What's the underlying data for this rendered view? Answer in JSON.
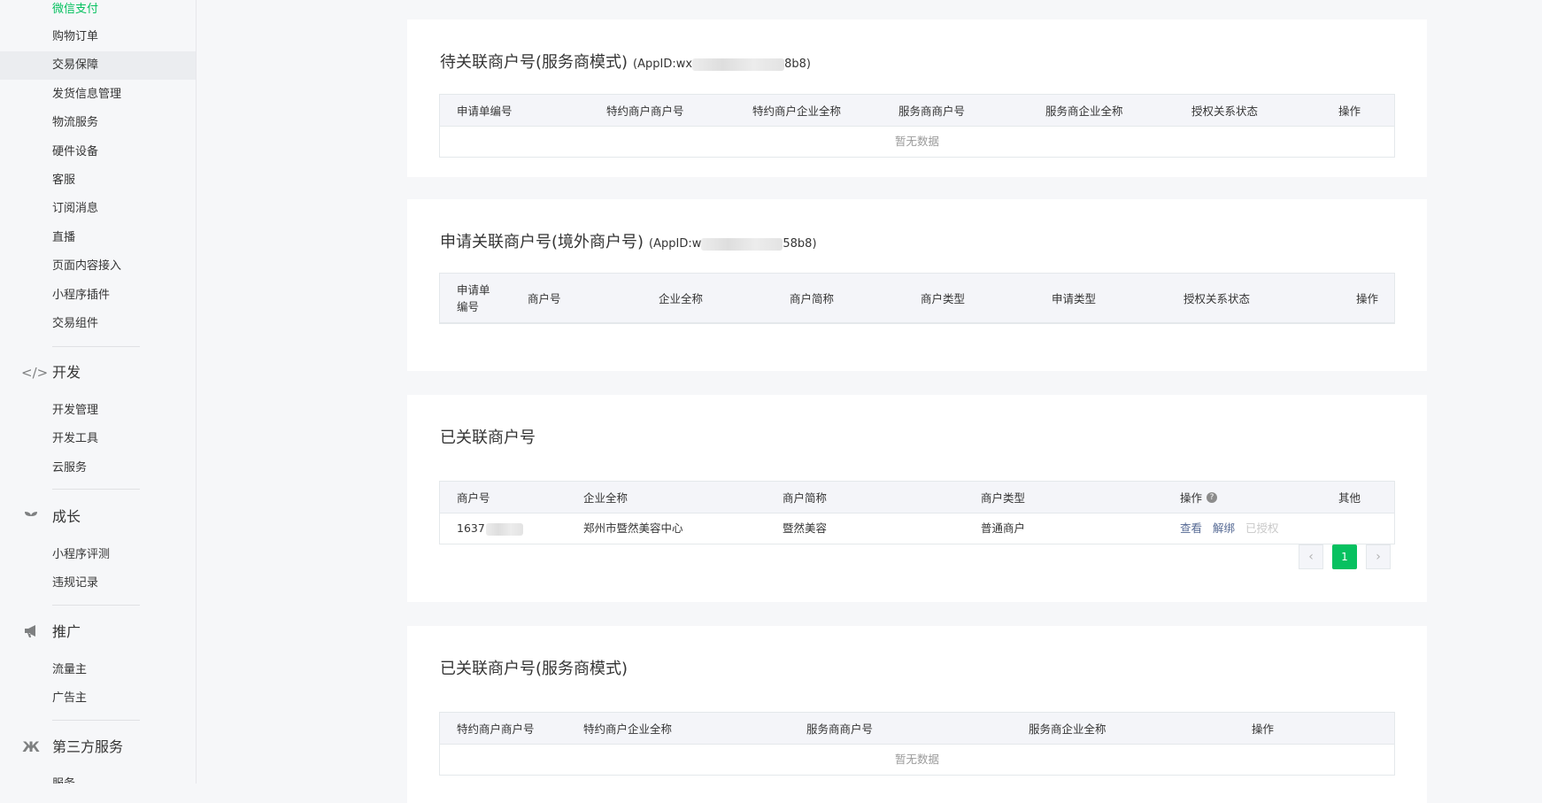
{
  "sidebar": {
    "items_top": [
      {
        "label": "微信支付"
      },
      {
        "label": "购物订单"
      },
      {
        "label": "交易保障"
      },
      {
        "label": "发货信息管理"
      },
      {
        "label": "物流服务"
      },
      {
        "label": "硬件设备"
      },
      {
        "label": "客服"
      },
      {
        "label": "订阅消息"
      },
      {
        "label": "直播"
      },
      {
        "label": "页面内容接入"
      },
      {
        "label": "小程序插件"
      },
      {
        "label": "交易组件"
      }
    ],
    "groups": [
      {
        "label": "开发",
        "icon": "code-icon",
        "items": [
          {
            "label": "开发管理"
          },
          {
            "label": "开发工具"
          },
          {
            "label": "云服务"
          }
        ]
      },
      {
        "label": "成长",
        "icon": "sprout-icon",
        "items": [
          {
            "label": "小程序评测"
          },
          {
            "label": "违规记录"
          }
        ]
      },
      {
        "label": "推广",
        "icon": "megaphone-icon",
        "items": [
          {
            "label": "流量主"
          },
          {
            "label": "广告主"
          }
        ]
      },
      {
        "label": "第三方服务",
        "icon": "third-party-icon",
        "items": [
          {
            "label": "服务"
          }
        ]
      }
    ]
  },
  "panel1": {
    "title": "待关联商户号(服务商模式)",
    "appid_prefix": "(AppID:wx",
    "appid_suffix": "8b8)",
    "columns": [
      "申请单编号",
      "特约商户商户号",
      "特约商户企业全称",
      "服务商商户号",
      "服务商企业全称",
      "授权关系状态",
      "操作"
    ],
    "empty_text": "暂无数据"
  },
  "panel2": {
    "title": "申请关联商户号(境外商户号)",
    "appid_prefix": "(AppID:w",
    "appid_suffix": "58b8)",
    "columns": [
      "申请单\n编号",
      "商户号",
      "企业全称",
      "商户简称",
      "商户类型",
      "申请类型",
      "授权关系状态",
      "操作"
    ]
  },
  "panel3": {
    "title": "已关联商户号",
    "columns": [
      "商户号",
      "企业全称",
      "商户简称",
      "商户类型",
      "操作",
      "其他"
    ],
    "row": {
      "merchant_id": "1637",
      "company": "郑州市暨然美容中心",
      "short_name": "暨然美容",
      "type": "普通商户",
      "view": "查看",
      "unbind": "解绑",
      "authorized": "已授权"
    },
    "pager": {
      "prev": "‹",
      "current": "1",
      "next": "›"
    }
  },
  "panel4": {
    "title": "已关联商户号(服务商模式)",
    "columns": [
      "特约商户商户号",
      "特约商户企业全称",
      "服务商商户号",
      "服务商企业全称",
      "操作"
    ],
    "empty_text": "暂无数据"
  },
  "colors": {
    "accent": "#07c160",
    "link": "#576b95"
  }
}
